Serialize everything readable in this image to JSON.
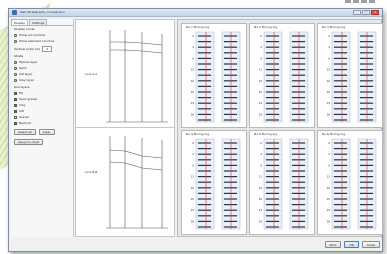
{
  "window": {
    "title": "Well Stratigraphy Comparison"
  },
  "left_panel": {
    "tabs": [
      {
        "label": "Display",
        "active": true
      },
      {
        "label": "Settings",
        "active": false
      }
    ],
    "display_group_label": "Display mode",
    "display_options": [
      {
        "label": "Show all columns",
        "selected": true
      },
      {
        "label": "Show selected columns",
        "selected": false
      }
    ],
    "scale_label": "Vertical scale (m)",
    "scale_value": "2",
    "section_label": "Strata",
    "strata": [
      {
        "label": "Topsoil layer",
        "selected": false
      },
      {
        "label": "Sand",
        "selected": true
      },
      {
        "label": "Silt layer",
        "selected": false
      },
      {
        "label": "Clay layer",
        "selected": false
      }
    ],
    "layers_label": "Soil layers",
    "layers": [
      {
        "label": "Fill",
        "checked": true
      },
      {
        "label": "Sand gravel",
        "checked": true
      },
      {
        "label": "Clay",
        "checked": true
      },
      {
        "label": "Silt",
        "checked": true
      },
      {
        "label": "Gravel",
        "checked": false
      },
      {
        "label": "Bedrock",
        "checked": true
      }
    ],
    "buttons": {
      "select_all": "Select all",
      "clear": "Clear",
      "apply": "Apply to chart"
    }
  },
  "profile": {
    "top_label": "Line A-A",
    "bottom_label": "Line B-B"
  },
  "charts": [
    {
      "title": "No.1 Boring log",
      "depths": [
        "0",
        "2",
        "4",
        "6",
        "8",
        "10",
        "12",
        "14",
        "16",
        "18",
        "20",
        "22",
        "24",
        "26",
        "28",
        "30"
      ]
    },
    {
      "title": "No.2 Boring log",
      "depths": [
        "0",
        "2",
        "4",
        "6",
        "8",
        "10",
        "12",
        "14",
        "16",
        "18",
        "20",
        "22",
        "24",
        "26",
        "28",
        "30"
      ]
    },
    {
      "title": "No.3 Boring log",
      "depths": [
        "0",
        "2",
        "4",
        "6",
        "8",
        "10",
        "12",
        "14",
        "16",
        "18",
        "20",
        "22",
        "24",
        "26",
        "28",
        "30"
      ]
    },
    {
      "title": "No.4 Boring log",
      "depths": [
        "0",
        "2",
        "4",
        "6",
        "8",
        "10",
        "12",
        "14",
        "16",
        "18",
        "20",
        "22",
        "24",
        "26",
        "28",
        "30"
      ]
    },
    {
      "title": "No.5 Boring log",
      "depths": [
        "0",
        "2",
        "4",
        "6",
        "8",
        "10",
        "12",
        "14",
        "16",
        "18",
        "20",
        "22",
        "24",
        "26",
        "28",
        "30"
      ]
    },
    {
      "title": "No.6 Boring log",
      "depths": [
        "0",
        "2",
        "4",
        "6",
        "8",
        "10",
        "12",
        "14",
        "16",
        "18",
        "20",
        "22",
        "24",
        "26",
        "28",
        "30"
      ]
    }
  ],
  "status": {
    "btn_print": "Print",
    "btn_ok": "OK",
    "btn_close": "Close"
  },
  "colors": {
    "accent": "#3b6fb6",
    "marker_red": "#d23c2a",
    "grid_blue": "#b8cce4"
  }
}
